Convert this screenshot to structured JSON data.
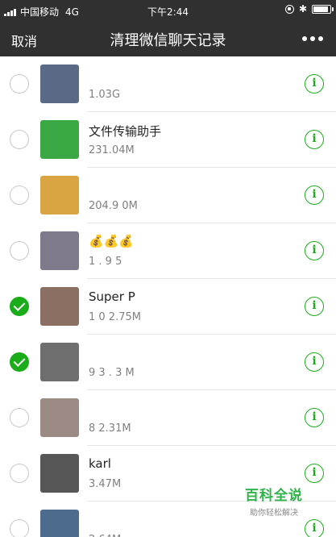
{
  "status_bar": {
    "carrier": "中国移动",
    "network": "4G",
    "time": "下午2:44"
  },
  "nav": {
    "cancel_label": "取消",
    "title": "清理微信聊天记录"
  },
  "chats": [
    {
      "name": "",
      "size": "1.03G",
      "checked": false,
      "avatar_color": "#5a6a86"
    },
    {
      "name": "文件传输助手",
      "size": "231.04M",
      "checked": false,
      "avatar_color": "#39a845"
    },
    {
      "name": "",
      "size": "204.9 0M",
      "checked": false,
      "avatar_color": "#d9a441"
    },
    {
      "name": "💰💰💰",
      "size": "1 . 9 5",
      "checked": false,
      "avatar_color": "#7e7a8c"
    },
    {
      "name": "Super P",
      "size": "1 0 2.75M",
      "checked": true,
      "avatar_color": "#8a6f62"
    },
    {
      "name": "",
      "size": "9 3 . 3 M",
      "checked": true,
      "avatar_color": "#6e6e6e"
    },
    {
      "name": "",
      "size": "8 2.31M",
      "checked": false,
      "avatar_color": "#9c8a85"
    },
    {
      "name": "karl",
      "size": "3.47M",
      "checked": false,
      "avatar_color": "#575757"
    },
    {
      "name": "",
      "size": "2.64M",
      "checked": false,
      "avatar_color": "#4d6b8c"
    }
  ],
  "watermark": {
    "main": "百科全说",
    "sub": "助你轻松解决"
  },
  "colors": {
    "nav_bg": "#303030",
    "accent_green": "#1aad19",
    "separator": "#e6e6e6"
  }
}
